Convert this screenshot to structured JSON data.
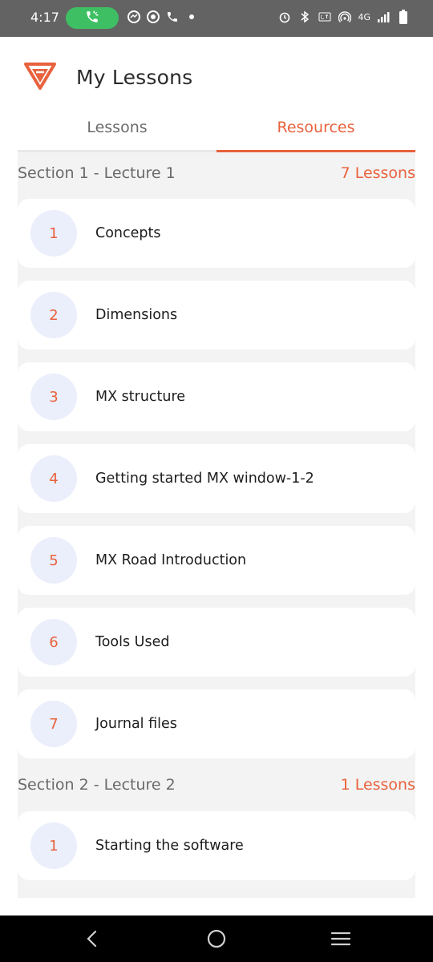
{
  "status_bar": {
    "time": "4:17",
    "network_label": "4G",
    "accent_call": "#3fbf63",
    "left_icons": [
      "call-active-icon",
      "messenger-icon",
      "whatsapp-icon",
      "phone-icon",
      "dot-icon"
    ],
    "right_icons": [
      "alarm-icon",
      "bluetooth-icon",
      "volte-icon",
      "hotspot-icon",
      "signal-icon",
      "battery-icon"
    ]
  },
  "header": {
    "title": "My Lessons",
    "logo_icon": "app-logo-icon"
  },
  "tabs": [
    {
      "label": "Lessons",
      "active": false
    },
    {
      "label": "Resources",
      "active": true
    }
  ],
  "colors": {
    "accent": "#e8623d",
    "number_bg": "#ebeefb",
    "content_bg": "#f3f3f3"
  },
  "sections": [
    {
      "title": "Section 1 - Lecture 1",
      "count": "7 Lessons",
      "lessons": [
        {
          "num": "1",
          "title": "Concepts"
        },
        {
          "num": "2",
          "title": "Dimensions"
        },
        {
          "num": "3",
          "title": "MX structure"
        },
        {
          "num": "4",
          "title": "Getting started MX window-1-2"
        },
        {
          "num": "5",
          "title": "MX Road Introduction"
        },
        {
          "num": "6",
          "title": "Tools Used"
        },
        {
          "num": "7",
          "title": "Journal files"
        }
      ]
    },
    {
      "title": "Section 2 - Lecture 2",
      "count": "1 Lessons",
      "lessons": [
        {
          "num": "1",
          "title": "Starting the software"
        }
      ]
    }
  ],
  "nav_bar": {
    "icons": [
      "back-icon",
      "home-icon",
      "recents-icon"
    ]
  }
}
